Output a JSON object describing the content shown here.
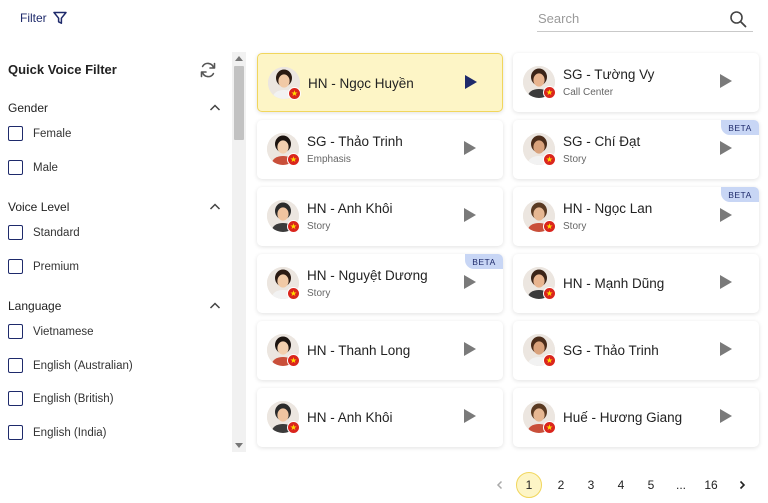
{
  "toolbar": {
    "filter_label": "Filter"
  },
  "search": {
    "placeholder": "Search",
    "value": ""
  },
  "sidebar": {
    "title": "Quick Voice Filter",
    "sections": [
      {
        "title": "Gender",
        "options": [
          "Female",
          "Male"
        ]
      },
      {
        "title": "Voice Level",
        "options": [
          "Standard",
          "Premium"
        ]
      },
      {
        "title": "Language",
        "options": [
          "Vietnamese",
          "English (Australian)",
          "English (British)",
          "English (India)"
        ]
      }
    ]
  },
  "voices": [
    {
      "name": "HN - Ngọc Huyền",
      "tag": "",
      "beta": "",
      "selected": true
    },
    {
      "name": "SG - Tường Vy",
      "tag": "Call Center",
      "beta": ""
    },
    {
      "name": "SG - Thảo Trinh",
      "tag": "Emphasis",
      "beta": ""
    },
    {
      "name": "SG - Chí Đạt",
      "tag": "Story",
      "beta": "BETA"
    },
    {
      "name": "HN - Anh Khôi",
      "tag": "Story",
      "beta": ""
    },
    {
      "name": "HN - Ngọc Lan",
      "tag": "Story",
      "beta": "BETA"
    },
    {
      "name": "HN - Nguyệt Dương",
      "tag": "Story",
      "beta": "BETA"
    },
    {
      "name": "HN - Mạnh Dũng",
      "tag": "",
      "beta": ""
    },
    {
      "name": "HN - Thanh Long",
      "tag": "",
      "beta": ""
    },
    {
      "name": "SG - Thảo Trinh",
      "tag": "",
      "beta": ""
    },
    {
      "name": "HN - Anh Khôi",
      "tag": "",
      "beta": ""
    },
    {
      "name": "Huế - Hương Giang",
      "tag": "",
      "beta": ""
    }
  ],
  "pagination": {
    "pages": [
      "1",
      "2",
      "3",
      "4",
      "5",
      "...",
      "16"
    ],
    "current": "1"
  },
  "colors": {
    "accent": "#1e2a6b",
    "selected_bg": "#fdf5c6",
    "selected_border": "#f1d65c",
    "beta_bg": "#c8d6f5",
    "flag_red": "#da251d"
  }
}
